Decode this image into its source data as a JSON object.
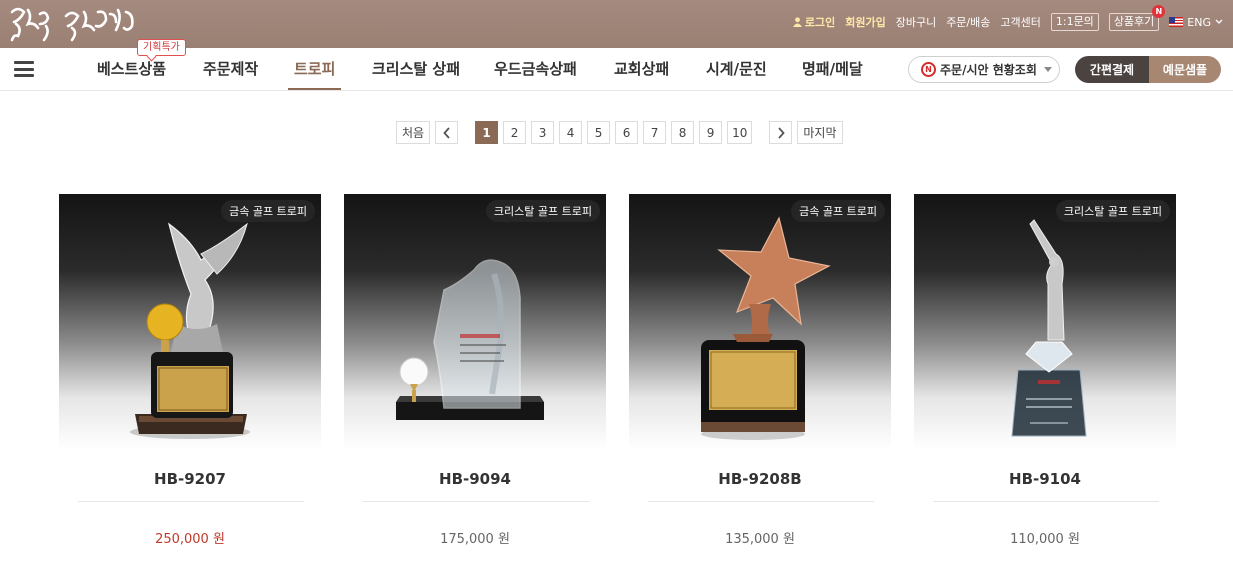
{
  "header": {
    "logo_text": "좋은사람 좋은상패",
    "util_nav": {
      "login": "로그인",
      "join": "회원가입",
      "cart": "장바구니",
      "order": "주문/배송",
      "support": "고객센터",
      "inquiry": "1:1문의",
      "reviews": "상품후기",
      "reviews_badge": "N",
      "lang": "ENG"
    }
  },
  "nav": {
    "items": [
      "베스트상품",
      "주문제작",
      "트로피",
      "크리스탈 상패",
      "우드금속상패",
      "교회상패",
      "시계/문진",
      "명패/메달"
    ],
    "active_index": 2,
    "promo_tag": "기획특가",
    "order_status_badge": "N",
    "order_status_label": "주문/시안 현황조회",
    "quick_pay": "간편결제",
    "sample": "예문샘플"
  },
  "pagination": {
    "first": "처음",
    "last": "마지막",
    "pages": [
      "1",
      "2",
      "3",
      "4",
      "5",
      "6",
      "7",
      "8",
      "9",
      "10"
    ],
    "current": "1"
  },
  "products": [
    {
      "category": "금속 골프 트로피",
      "code": "HB-9207",
      "price": "250,000 원",
      "price_color": "#c0392b"
    },
    {
      "category": "크리스탈 골프 트로피",
      "code": "HB-9094",
      "price": "175,000 원",
      "price_color": "#666666"
    },
    {
      "category": "금속 골프 트로피",
      "code": "HB-9208B",
      "price": "135,000 원",
      "price_color": "#666666"
    },
    {
      "category": "크리스탈 골프 트로피",
      "code": "HB-9104",
      "price": "110,000 원",
      "price_color": "#666666"
    }
  ],
  "theme": {
    "brand_brown": "#8b6a55",
    "topbar": "#9a7f73",
    "dark_button": "#4b4340",
    "light_button": "#a78772"
  }
}
